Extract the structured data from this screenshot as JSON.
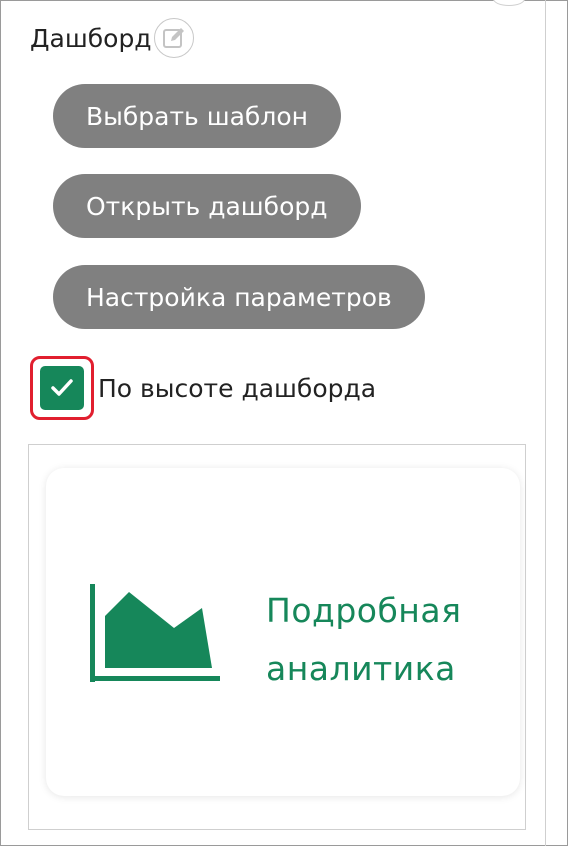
{
  "panel": {
    "title": "Дашборд",
    "edit_icon": "edit-icon"
  },
  "buttons": {
    "choose_template": "Выбрать шаблон",
    "open_dashboard": "Открыть дашборд",
    "parameter_settings": "Настройка параметров"
  },
  "checkbox": {
    "label": "По высоте дашборда",
    "checked": true,
    "icon": "checkmark-icon"
  },
  "preview": {
    "title_line1": "Подробная",
    "title_line2": "аналитика",
    "icon": "area-chart-icon"
  },
  "colors": {
    "accent": "#16875a",
    "button_bg": "#808080",
    "highlight": "#e11f2f"
  }
}
